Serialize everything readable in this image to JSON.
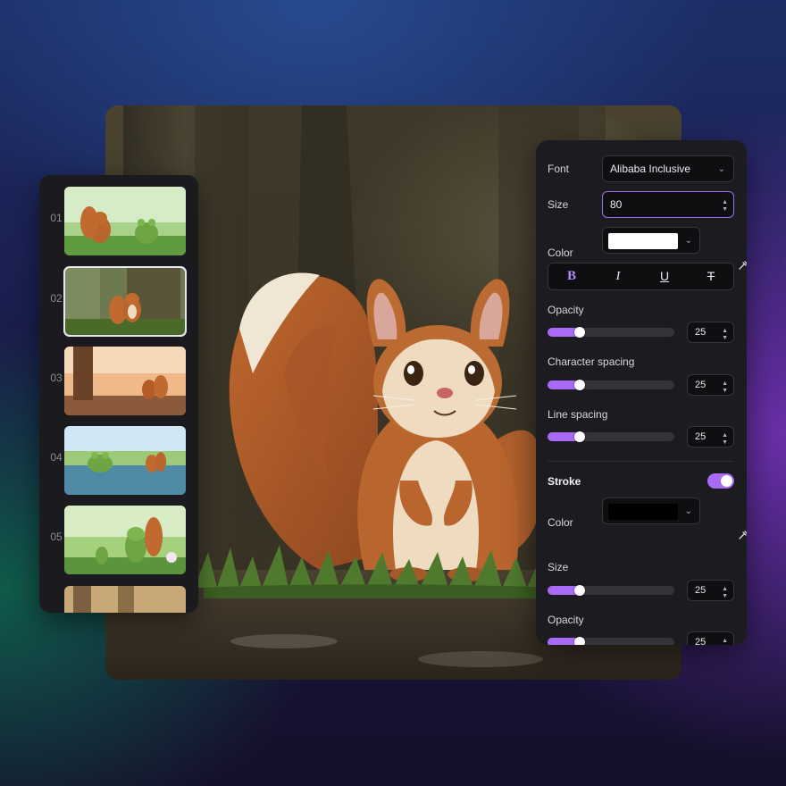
{
  "scenes": [
    {
      "number": "01",
      "selected": false,
      "theme": "meadow"
    },
    {
      "number": "02",
      "selected": true,
      "theme": "forest"
    },
    {
      "number": "03",
      "selected": false,
      "theme": "sunset"
    },
    {
      "number": "04",
      "selected": false,
      "theme": "pond"
    },
    {
      "number": "05",
      "selected": false,
      "theme": "garden"
    },
    {
      "number": "",
      "selected": false,
      "theme": "partial"
    }
  ],
  "properties": {
    "font": {
      "label": "Font",
      "value": "Alibaba Inclusive"
    },
    "size": {
      "label": "Size",
      "value": "80"
    },
    "color": {
      "label": "Color",
      "value": "#ffffff"
    },
    "format_buttons": [
      {
        "name": "bold",
        "glyph": "B",
        "active": true
      },
      {
        "name": "italic",
        "glyph": "I",
        "active": false
      },
      {
        "name": "underline",
        "glyph": "U",
        "active": false
      },
      {
        "name": "strikethrough",
        "glyph": "T",
        "active": false
      }
    ],
    "opacity": {
      "label": "Opacity",
      "value": "25",
      "level": 0.25
    },
    "character_spacing": {
      "label": "Character spacing",
      "value": "25",
      "level": 0.25
    },
    "line_spacing": {
      "label": "Line spacing",
      "value": "25",
      "level": 0.25
    },
    "stroke": {
      "label": "Stroke",
      "enabled": true,
      "color": {
        "label": "Color",
        "value": "#000000"
      },
      "size": {
        "label": "Size",
        "value": "25",
        "level": 0.25
      },
      "opacity": {
        "label": "Opacity",
        "value": "25",
        "level": 0.25
      }
    }
  },
  "icons": {
    "dropdown": "chevron-down-icon",
    "eyedropper": "eyedropper-icon",
    "stepper": "stepper-icon"
  },
  "colors": {
    "accent": "#a96af5",
    "panel": "#1c1c20"
  }
}
